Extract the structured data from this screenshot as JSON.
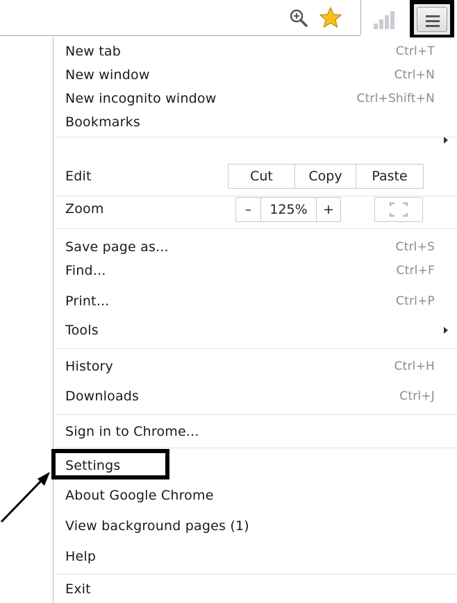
{
  "toolbar": {
    "icons": [
      "zoom-icon",
      "star-icon",
      "signal-icon",
      "menu-icon"
    ]
  },
  "menu": {
    "new_tab": {
      "label": "New tab",
      "shortcut": "Ctrl+T"
    },
    "new_window": {
      "label": "New window",
      "shortcut": "Ctrl+N"
    },
    "new_incognito": {
      "label": "New incognito window",
      "shortcut": "Ctrl+Shift+N"
    },
    "bookmarks": {
      "label": "Bookmarks"
    },
    "edit": {
      "label": "Edit",
      "cut": "Cut",
      "copy": "Copy",
      "paste": "Paste"
    },
    "zoom": {
      "label": "Zoom",
      "minus": "–",
      "level": "125%",
      "plus": "+"
    },
    "save_page": {
      "label": "Save page as...",
      "shortcut": "Ctrl+S"
    },
    "find": {
      "label": "Find...",
      "shortcut": "Ctrl+F"
    },
    "print": {
      "label": "Print...",
      "shortcut": "Ctrl+P"
    },
    "tools": {
      "label": "Tools"
    },
    "history": {
      "label": "History",
      "shortcut": "Ctrl+H"
    },
    "downloads": {
      "label": "Downloads",
      "shortcut": "Ctrl+J"
    },
    "sign_in": {
      "label": "Sign in to Chrome..."
    },
    "settings": {
      "label": "Settings"
    },
    "about": {
      "label": "About Google Chrome"
    },
    "background_pages": {
      "label": "View background pages (1)"
    },
    "help": {
      "label": "Help"
    },
    "exit": {
      "label": "Exit"
    }
  },
  "colors": {
    "shortcut_text": "#8c8c8c",
    "highlight_border": "#000000",
    "star_fill": "#f6c21a"
  }
}
